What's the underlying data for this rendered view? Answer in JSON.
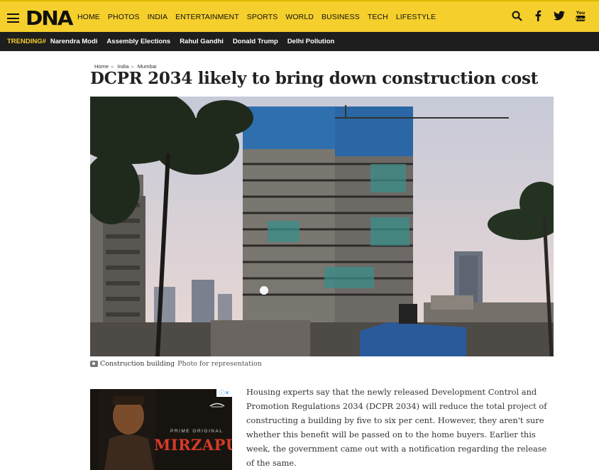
{
  "header": {
    "logo": "DNA",
    "nav": [
      "HOME",
      "PHOTOS",
      "INDIA",
      "ENTERTAINMENT",
      "SPORTS",
      "WORLD",
      "BUSINESS",
      "TECH",
      "LIFESTYLE"
    ]
  },
  "trending": {
    "label": "TRENDING#",
    "items": [
      "Narendra Modi",
      "Assembly Elections",
      "Rahul Gandhi",
      "Donald Trump",
      "Delhi Pollution"
    ]
  },
  "article": {
    "breadcrumb": [
      "Home",
      "India",
      "Mumbai"
    ],
    "breadcrumb_sep": "»",
    "headline": "DCPR 2034 likely to bring down construction cost",
    "caption_label": "Construction building",
    "caption_text": "Photo for representation",
    "body": "Housing experts say that the newly released Development Control and Promotion Regulations 2034 (DCPR 2034) will reduce the total project of constructing a building by five to six per cent. However, they aren't sure whether this benefit will be passed on to the home buyers. Earlier this week, the government came out with a notification regarding the release of the same."
  },
  "ad": {
    "choice": "ⓘ✕",
    "prime": "PRIME ORIGINAL",
    "title": "MIRZAPUR"
  },
  "colors": {
    "brand_yellow": "#f5cf2c",
    "trending_bg": "#1e1e1e"
  },
  "icons": {
    "menu": "hamburger-icon",
    "search": "search-icon",
    "facebook": "facebook-icon",
    "twitter": "twitter-icon",
    "youtube": "youtube-icon",
    "camera": "camera-icon"
  }
}
